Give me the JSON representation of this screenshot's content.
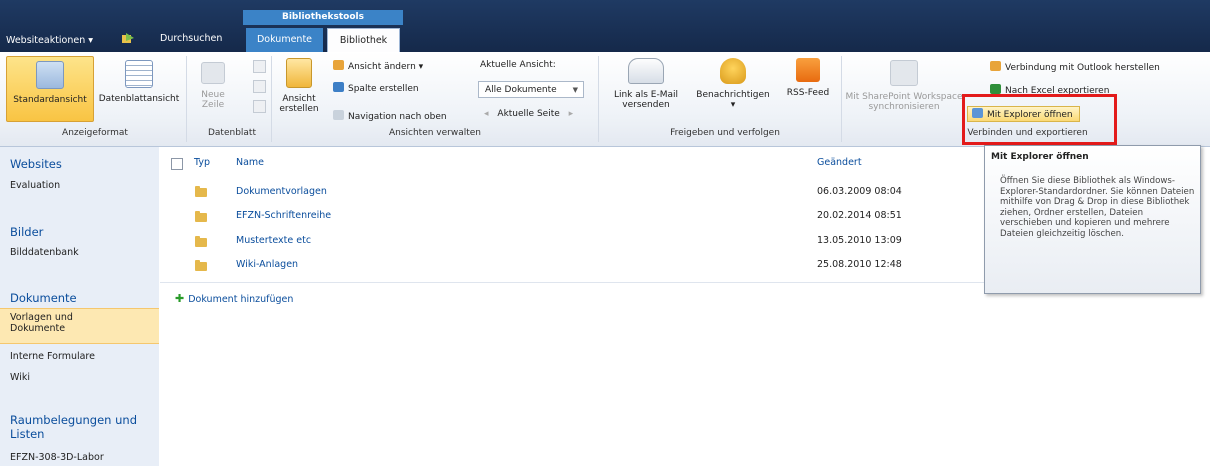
{
  "top": {
    "site_actions": "Websiteaktionen ▾",
    "browse_tab": "Durchsuchen",
    "context_group": "Bibliothekstools",
    "tab_documents": "Dokumente",
    "tab_library": "Bibliothek"
  },
  "ribbon": {
    "standard_view": "Standardansicht",
    "datasheet_view": "Datenblattansicht",
    "new_row_1": "Neue",
    "new_row_2": "Zeile",
    "create_view_1": "Ansicht",
    "create_view_2": "erstellen",
    "modify_view": "Ansicht ändern ▾",
    "create_column": "Spalte erstellen",
    "navigate_up": "Navigation nach oben",
    "current_view_label": "Aktuelle Ansicht:",
    "current_view_value": "Alle Dokumente",
    "current_page": "Aktuelle Seite",
    "email_link_1": "Link als E-Mail",
    "email_link_2": "versenden",
    "alert_me": "Benachrichtigen",
    "alert_me_arrow": "▾",
    "rss_feed": "RSS-Feed",
    "sync_workspace_1": "Mit SharePoint Workspace",
    "sync_workspace_2": "synchronisieren",
    "connect_outlook": "Verbindung mit Outlook herstellen",
    "export_excel": "Nach Excel exportieren",
    "open_explorer": "Mit Explorer öffnen",
    "groups": {
      "format": "Anzeigeformat",
      "datasheet": "Datenblatt",
      "manage_views": "Ansichten verwalten",
      "share_track": "Freigeben und verfolgen",
      "connect_export": "Verbinden und exportieren"
    }
  },
  "leftnav": {
    "websites": "Websites",
    "evaluation": "Evaluation",
    "images": "Bilder",
    "image_db": "Bilddatenbank",
    "documents": "Dokumente",
    "templates_1": "Vorlagen und",
    "templates_2": "Dokumente",
    "internal_forms": "Interne Formulare",
    "wiki": "Wiki",
    "room_1": "Raumbelegungen und",
    "room_2": "Listen",
    "lab": "EFZN-308-3D-Labor"
  },
  "list": {
    "col_type": "Typ",
    "col_name": "Name",
    "col_modified": "Geändert",
    "rows": [
      {
        "name": "Dokumentvorlagen",
        "modified": "06.03.2009 08:04"
      },
      {
        "name": "EFZN-Schriftenreihe",
        "modified": "20.02.2014 08:51"
      },
      {
        "name": "Mustertexte etc",
        "modified": "13.05.2010 13:09"
      },
      {
        "name": "Wiki-Anlagen",
        "modified": "25.08.2010 12:48"
      }
    ],
    "add_document": "Dokument hinzufügen"
  },
  "tooltip": {
    "title": "Mit Explorer öffnen",
    "body": "Öffnen Sie diese Bibliothek als Windows-Explorer-Standardordner. Sie können Dateien mithilfe von Drag & Drop in diese Bibliothek ziehen, Ordner erstellen, Dateien verschieben und kopieren und mehrere Dateien gleichzeitig löschen."
  },
  "colors": {
    "top_bar": "#1f3a63",
    "context_tab": "#3b83c7",
    "link": "#0a4d9c",
    "selected": "#f9c443",
    "highlight_box": "#e31b1b"
  }
}
